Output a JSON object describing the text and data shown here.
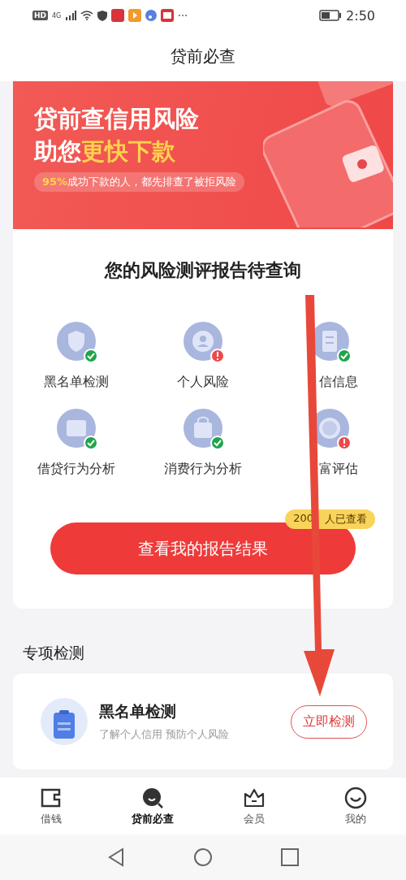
{
  "status_bar": {
    "hd": "HD",
    "network": "4G",
    "time": "2:50"
  },
  "title": "贷前必查",
  "banner": {
    "line1": "贷前查信用风险",
    "line2_start": "助您",
    "line2_highlight": "更快下款",
    "note_highlight": "95%",
    "note_rest": "成功下款的人，都先排查了被拒风险"
  },
  "report": {
    "heading": "您的风险测评报告待查询",
    "items": [
      {
        "kind": "shield",
        "label": "黑名单检测",
        "passed": true
      },
      {
        "kind": "person",
        "label": "个人风险",
        "passed": false
      },
      {
        "kind": "document",
        "label": "信信息",
        "passed": true
      },
      {
        "kind": "wallet",
        "label": "借贷行为分析",
        "passed": true
      },
      {
        "kind": "bag",
        "label": "消费行为分析",
        "passed": true
      },
      {
        "kind": "coin",
        "label": "富评估",
        "passed": false
      }
    ],
    "button": "查看我的报告结果",
    "badge_start": "200",
    "badge_end": "人已查看"
  },
  "section_title": "专项检测",
  "special": {
    "title": "黑名单检测",
    "subtitle": "了解个人信用 预防个人风险",
    "button": "立即检测"
  },
  "nav": [
    {
      "kind": "wallet",
      "label": "借钱",
      "selected": false
    },
    {
      "kind": "search",
      "label": "贷前必查",
      "selected": true
    },
    {
      "kind": "crown",
      "label": "会员",
      "selected": false
    },
    {
      "kind": "smile",
      "label": "我的",
      "selected": false
    }
  ]
}
